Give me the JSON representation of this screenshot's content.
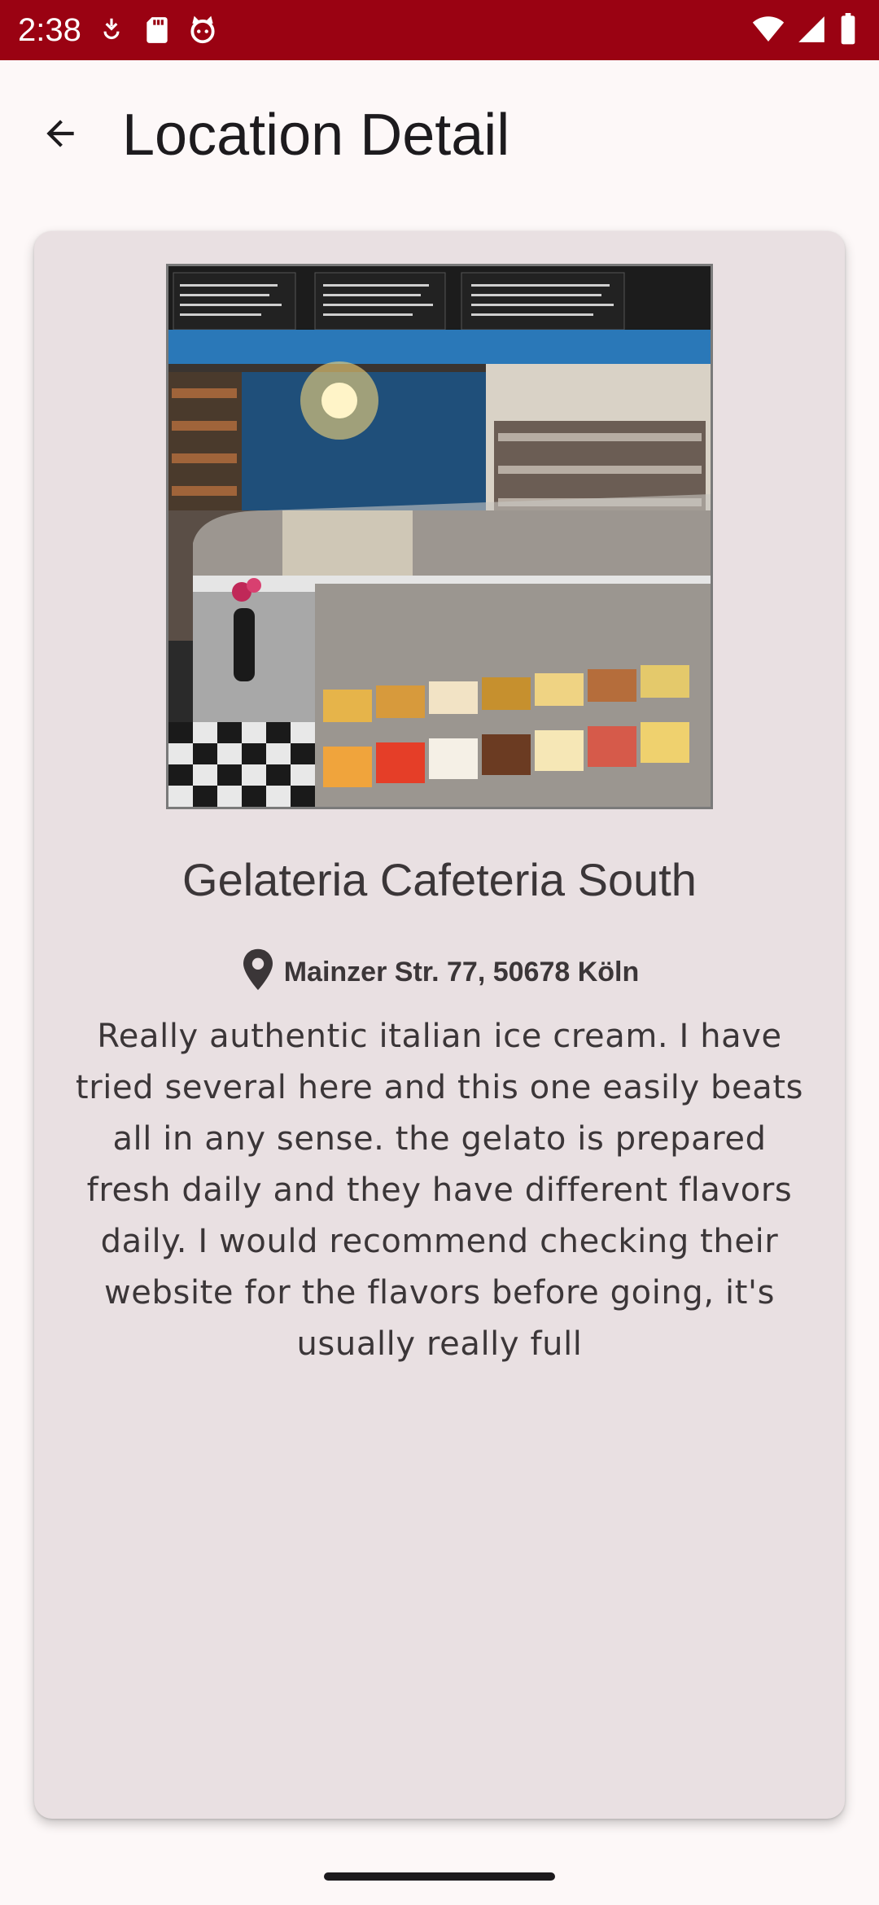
{
  "status_bar": {
    "time": "2:38",
    "left_icons": [
      "data-saver-icon",
      "sd-card-icon",
      "cat-face-icon"
    ],
    "right_icons": [
      "wifi-icon",
      "signal-icon",
      "battery-icon"
    ],
    "background": "#9a0212"
  },
  "app_bar": {
    "title": "Location Detail",
    "back_icon": "arrow-back-icon"
  },
  "location": {
    "name": "Gelateria Cafeteria South",
    "address": "Mainzer Str. 77, 50678 Köln",
    "description": "Really authentic italian ice cream. I have tried several here and this one easily beats all in any sense. the gelato is prepared fresh daily and they have different flavors daily. I would recommend checking their website for the flavors before going, it's usually really full",
    "photo": "gelateria-interior-photo"
  },
  "colors": {
    "card_bg": "#e9e0e2",
    "page_bg": "#fdf8f8",
    "text": "#3b3638"
  }
}
